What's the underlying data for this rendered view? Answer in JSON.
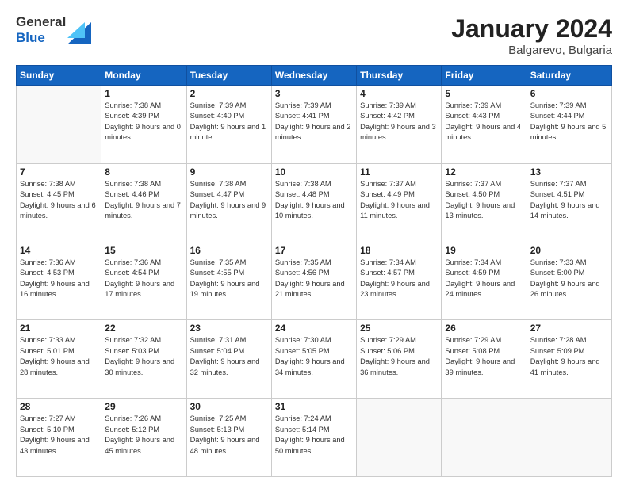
{
  "header": {
    "logo_general": "General",
    "logo_blue": "Blue",
    "month_year": "January 2024",
    "location": "Balgarevo, Bulgaria"
  },
  "weekdays": [
    "Sunday",
    "Monday",
    "Tuesday",
    "Wednesday",
    "Thursday",
    "Friday",
    "Saturday"
  ],
  "weeks": [
    [
      {
        "day": "",
        "sunrise": "",
        "sunset": "",
        "daylight": "",
        "empty": true
      },
      {
        "day": "1",
        "sunrise": "Sunrise: 7:38 AM",
        "sunset": "Sunset: 4:39 PM",
        "daylight": "Daylight: 9 hours and 0 minutes.",
        "empty": false
      },
      {
        "day": "2",
        "sunrise": "Sunrise: 7:39 AM",
        "sunset": "Sunset: 4:40 PM",
        "daylight": "Daylight: 9 hours and 1 minute.",
        "empty": false
      },
      {
        "day": "3",
        "sunrise": "Sunrise: 7:39 AM",
        "sunset": "Sunset: 4:41 PM",
        "daylight": "Daylight: 9 hours and 2 minutes.",
        "empty": false
      },
      {
        "day": "4",
        "sunrise": "Sunrise: 7:39 AM",
        "sunset": "Sunset: 4:42 PM",
        "daylight": "Daylight: 9 hours and 3 minutes.",
        "empty": false
      },
      {
        "day": "5",
        "sunrise": "Sunrise: 7:39 AM",
        "sunset": "Sunset: 4:43 PM",
        "daylight": "Daylight: 9 hours and 4 minutes.",
        "empty": false
      },
      {
        "day": "6",
        "sunrise": "Sunrise: 7:39 AM",
        "sunset": "Sunset: 4:44 PM",
        "daylight": "Daylight: 9 hours and 5 minutes.",
        "empty": false
      }
    ],
    [
      {
        "day": "7",
        "sunrise": "Sunrise: 7:38 AM",
        "sunset": "Sunset: 4:45 PM",
        "daylight": "Daylight: 9 hours and 6 minutes.",
        "empty": false
      },
      {
        "day": "8",
        "sunrise": "Sunrise: 7:38 AM",
        "sunset": "Sunset: 4:46 PM",
        "daylight": "Daylight: 9 hours and 7 minutes.",
        "empty": false
      },
      {
        "day": "9",
        "sunrise": "Sunrise: 7:38 AM",
        "sunset": "Sunset: 4:47 PM",
        "daylight": "Daylight: 9 hours and 9 minutes.",
        "empty": false
      },
      {
        "day": "10",
        "sunrise": "Sunrise: 7:38 AM",
        "sunset": "Sunset: 4:48 PM",
        "daylight": "Daylight: 9 hours and 10 minutes.",
        "empty": false
      },
      {
        "day": "11",
        "sunrise": "Sunrise: 7:37 AM",
        "sunset": "Sunset: 4:49 PM",
        "daylight": "Daylight: 9 hours and 11 minutes.",
        "empty": false
      },
      {
        "day": "12",
        "sunrise": "Sunrise: 7:37 AM",
        "sunset": "Sunset: 4:50 PM",
        "daylight": "Daylight: 9 hours and 13 minutes.",
        "empty": false
      },
      {
        "day": "13",
        "sunrise": "Sunrise: 7:37 AM",
        "sunset": "Sunset: 4:51 PM",
        "daylight": "Daylight: 9 hours and 14 minutes.",
        "empty": false
      }
    ],
    [
      {
        "day": "14",
        "sunrise": "Sunrise: 7:36 AM",
        "sunset": "Sunset: 4:53 PM",
        "daylight": "Daylight: 9 hours and 16 minutes.",
        "empty": false
      },
      {
        "day": "15",
        "sunrise": "Sunrise: 7:36 AM",
        "sunset": "Sunset: 4:54 PM",
        "daylight": "Daylight: 9 hours and 17 minutes.",
        "empty": false
      },
      {
        "day": "16",
        "sunrise": "Sunrise: 7:35 AM",
        "sunset": "Sunset: 4:55 PM",
        "daylight": "Daylight: 9 hours and 19 minutes.",
        "empty": false
      },
      {
        "day": "17",
        "sunrise": "Sunrise: 7:35 AM",
        "sunset": "Sunset: 4:56 PM",
        "daylight": "Daylight: 9 hours and 21 minutes.",
        "empty": false
      },
      {
        "day": "18",
        "sunrise": "Sunrise: 7:34 AM",
        "sunset": "Sunset: 4:57 PM",
        "daylight": "Daylight: 9 hours and 23 minutes.",
        "empty": false
      },
      {
        "day": "19",
        "sunrise": "Sunrise: 7:34 AM",
        "sunset": "Sunset: 4:59 PM",
        "daylight": "Daylight: 9 hours and 24 minutes.",
        "empty": false
      },
      {
        "day": "20",
        "sunrise": "Sunrise: 7:33 AM",
        "sunset": "Sunset: 5:00 PM",
        "daylight": "Daylight: 9 hours and 26 minutes.",
        "empty": false
      }
    ],
    [
      {
        "day": "21",
        "sunrise": "Sunrise: 7:33 AM",
        "sunset": "Sunset: 5:01 PM",
        "daylight": "Daylight: 9 hours and 28 minutes.",
        "empty": false
      },
      {
        "day": "22",
        "sunrise": "Sunrise: 7:32 AM",
        "sunset": "Sunset: 5:03 PM",
        "daylight": "Daylight: 9 hours and 30 minutes.",
        "empty": false
      },
      {
        "day": "23",
        "sunrise": "Sunrise: 7:31 AM",
        "sunset": "Sunset: 5:04 PM",
        "daylight": "Daylight: 9 hours and 32 minutes.",
        "empty": false
      },
      {
        "day": "24",
        "sunrise": "Sunrise: 7:30 AM",
        "sunset": "Sunset: 5:05 PM",
        "daylight": "Daylight: 9 hours and 34 minutes.",
        "empty": false
      },
      {
        "day": "25",
        "sunrise": "Sunrise: 7:29 AM",
        "sunset": "Sunset: 5:06 PM",
        "daylight": "Daylight: 9 hours and 36 minutes.",
        "empty": false
      },
      {
        "day": "26",
        "sunrise": "Sunrise: 7:29 AM",
        "sunset": "Sunset: 5:08 PM",
        "daylight": "Daylight: 9 hours and 39 minutes.",
        "empty": false
      },
      {
        "day": "27",
        "sunrise": "Sunrise: 7:28 AM",
        "sunset": "Sunset: 5:09 PM",
        "daylight": "Daylight: 9 hours and 41 minutes.",
        "empty": false
      }
    ],
    [
      {
        "day": "28",
        "sunrise": "Sunrise: 7:27 AM",
        "sunset": "Sunset: 5:10 PM",
        "daylight": "Daylight: 9 hours and 43 minutes.",
        "empty": false
      },
      {
        "day": "29",
        "sunrise": "Sunrise: 7:26 AM",
        "sunset": "Sunset: 5:12 PM",
        "daylight": "Daylight: 9 hours and 45 minutes.",
        "empty": false
      },
      {
        "day": "30",
        "sunrise": "Sunrise: 7:25 AM",
        "sunset": "Sunset: 5:13 PM",
        "daylight": "Daylight: 9 hours and 48 minutes.",
        "empty": false
      },
      {
        "day": "31",
        "sunrise": "Sunrise: 7:24 AM",
        "sunset": "Sunset: 5:14 PM",
        "daylight": "Daylight: 9 hours and 50 minutes.",
        "empty": false
      },
      {
        "day": "",
        "sunrise": "",
        "sunset": "",
        "daylight": "",
        "empty": true
      },
      {
        "day": "",
        "sunrise": "",
        "sunset": "",
        "daylight": "",
        "empty": true
      },
      {
        "day": "",
        "sunrise": "",
        "sunset": "",
        "daylight": "",
        "empty": true
      }
    ]
  ]
}
